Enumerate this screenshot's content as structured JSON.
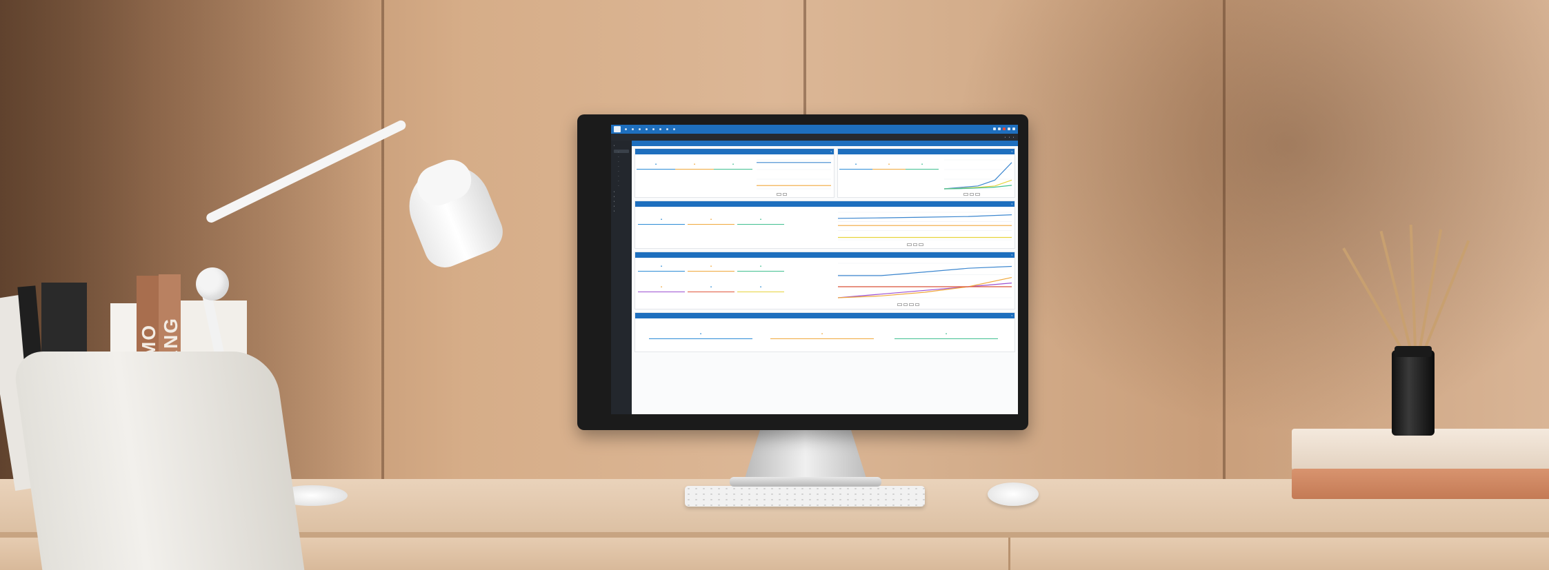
{
  "app": {
    "title": "",
    "nav": [
      "",
      "",
      "",
      "",
      "",
      "",
      "",
      ""
    ]
  },
  "sidebar": {
    "items": []
  },
  "breadcrumb": {
    "left": "",
    "right": ""
  },
  "cards": [],
  "colors": {
    "primary": "#1e6fbe",
    "topbar": "#1e6fbe",
    "sidebar": "#23272d",
    "stat_blue": "#2a8bd6",
    "stat_orange": "#f0a73a",
    "stat_green": "#3fbf8f",
    "series_blue": "#3b86cf",
    "series_orange": "#f0a73a",
    "series_yellow": "#e6d33a",
    "series_purple": "#9b4fd1",
    "series_red": "#e0553a"
  },
  "icons": [
    "app-logo-icon",
    "notification-icon",
    "alert-icon",
    "settings-icon",
    "user-icon"
  ],
  "chart_data": [
    {
      "type": "line",
      "title": "",
      "series": [
        {
          "values": [
            8,
            8,
            8,
            8,
            8
          ]
        },
        {
          "values": [
            1,
            1,
            1,
            1,
            1
          ]
        }
      ]
    },
    {
      "type": "line",
      "title": "",
      "series": [
        {
          "values": [
            0,
            0.5,
            1,
            3,
            9
          ]
        },
        {
          "values": [
            0,
            0.2,
            0.5,
            1,
            3
          ]
        },
        {
          "values": [
            0,
            0.1,
            0.3,
            0.6,
            1.2
          ]
        }
      ]
    },
    {
      "type": "line",
      "title": "",
      "series": [
        {
          "values": [
            9,
            9.2,
            9.5,
            9.8,
            10.5
          ]
        },
        {
          "values": [
            6,
            6,
            6,
            6,
            6
          ]
        },
        {
          "values": [
            1,
            1,
            1,
            1,
            1
          ]
        }
      ]
    },
    {
      "type": "line",
      "title": "",
      "series": [
        {
          "values": [
            6,
            6,
            7,
            8,
            8.5
          ]
        },
        {
          "values": [
            0,
            1,
            2,
            3,
            4
          ]
        },
        {
          "values": [
            0,
            0.5,
            1.5,
            3,
            5.5
          ]
        },
        {
          "values": [
            3,
            3,
            3,
            3,
            3
          ]
        }
      ]
    }
  ]
}
